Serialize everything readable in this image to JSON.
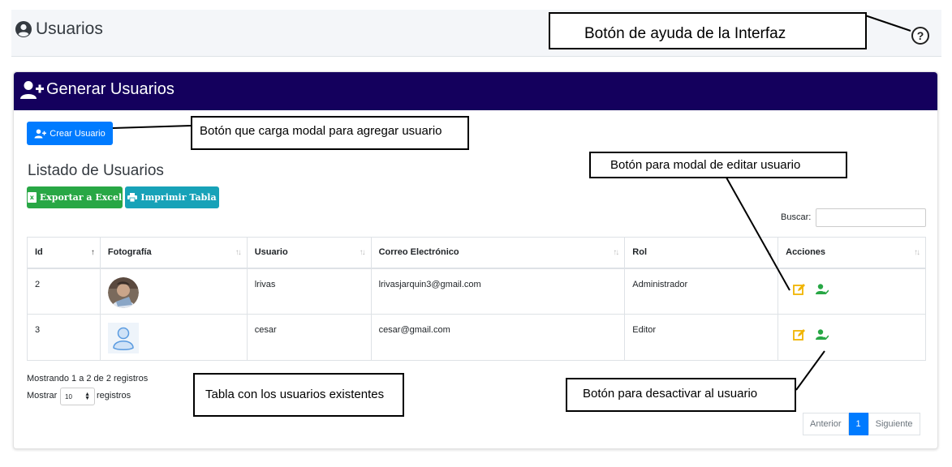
{
  "header": {
    "title": "Usuarios",
    "help_icon": "question-circle-icon"
  },
  "card": {
    "title": "Generar Usuarios",
    "header_color": "#14005d"
  },
  "toolbar": {
    "create_label": "Crear Usuario",
    "list_title": "Listado de Usuarios",
    "excel_label": "Exportar a Excel",
    "print_label": "Imprimir Tabla",
    "search_label": "Buscar:",
    "search_value": ""
  },
  "table": {
    "columns": [
      "Id",
      "Fotografía",
      "Usuario",
      "Correo Electrónico",
      "Rol",
      "Acciones"
    ],
    "rows": [
      {
        "id": "2",
        "photo": "photo-avatar",
        "usuario": "lrivas",
        "correo": "lrivasjarquin3@gmail.com",
        "rol": "Administrador"
      },
      {
        "id": "3",
        "photo": "default-user-avatar",
        "usuario": "cesar",
        "correo": "cesar@gmail.com",
        "rol": "Editor"
      }
    ]
  },
  "footer": {
    "info": "Mostrando 1 a 2 de 2 registros",
    "show_label": "Mostrar",
    "page_length": "10",
    "records_label": "registros",
    "prev": "Anterior",
    "page": "1",
    "next": "Siguiente"
  },
  "annotations": {
    "help": "Botón de ayuda de la Interfaz",
    "create": "Botón que carga modal para agregar usuario",
    "edit": "Botón para modal de editar usuario",
    "table": "Tabla con los usuarios existentes",
    "deactivate": "Botón para desactivar al usuario"
  },
  "colors": {
    "primary": "#007bff",
    "success": "#28a745",
    "info": "#17a2b8",
    "edit_icon": "#f0b400",
    "deactivate_icon": "#28a745"
  }
}
